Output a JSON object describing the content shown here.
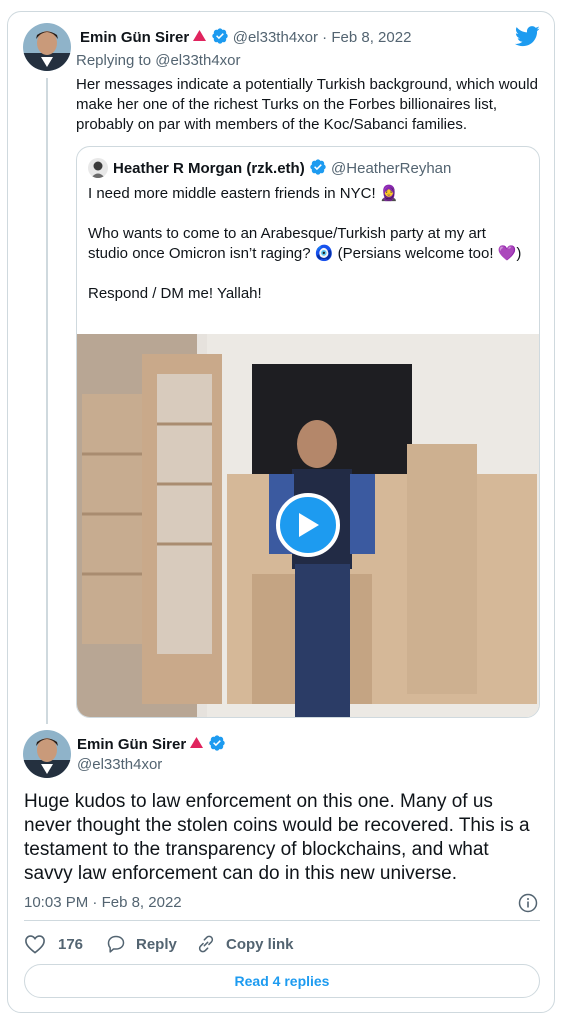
{
  "first_tweet": {
    "author_name": "Emin Gün Sirer",
    "handle": "@el33th4xor",
    "separator": "·",
    "date": "Feb 8, 2022",
    "replying_label": "Replying to",
    "replying_handle": "@el33th4xor",
    "body": "Her messages indicate a potentially Turkish background, which would make her one of the richest Turks on the Forbes billionaires list, probably on par with members of the Koc/Sabanci families."
  },
  "quoted_tweet": {
    "author_name": "Heather R Morgan (rzk.eth)",
    "handle": "@HeatherReyhan",
    "line1": "I need more middle eastern friends in NYC! 🧕",
    "line2": "Who wants to come to an Arabesque/Turkish party at my art studio once Omicron isn’t raging? 🧿 (Persians welcome too! 💜)",
    "line3": "Respond / DM me! Yallah!"
  },
  "main_tweet": {
    "author_name": "Emin Gün Sirer",
    "handle": "@el33th4xor",
    "body": "Huge kudos to law enforcement on this one. Many of us never thought the stolen coins would be recovered. This is a testament to the transparency of blockchains, and what savvy law enforcement can do in this new universe.",
    "time": "10:03 PM",
    "separator": "·",
    "date": "Feb 8, 2022"
  },
  "actions": {
    "like_count": "176",
    "reply_label": "Reply",
    "copy_link_label": "Copy link"
  },
  "read_replies_label": "Read 4 replies",
  "colors": {
    "brand_blue": "#1d9bf0",
    "text": "#0f1419",
    "muted": "#536471",
    "border": "#cfd9de",
    "red_triangle": "#e0245e"
  },
  "icons": [
    "twitter-bird-icon",
    "verified-badge-icon",
    "red-triangle-icon",
    "play-icon",
    "info-icon",
    "heart-icon",
    "reply-icon",
    "link-icon"
  ]
}
